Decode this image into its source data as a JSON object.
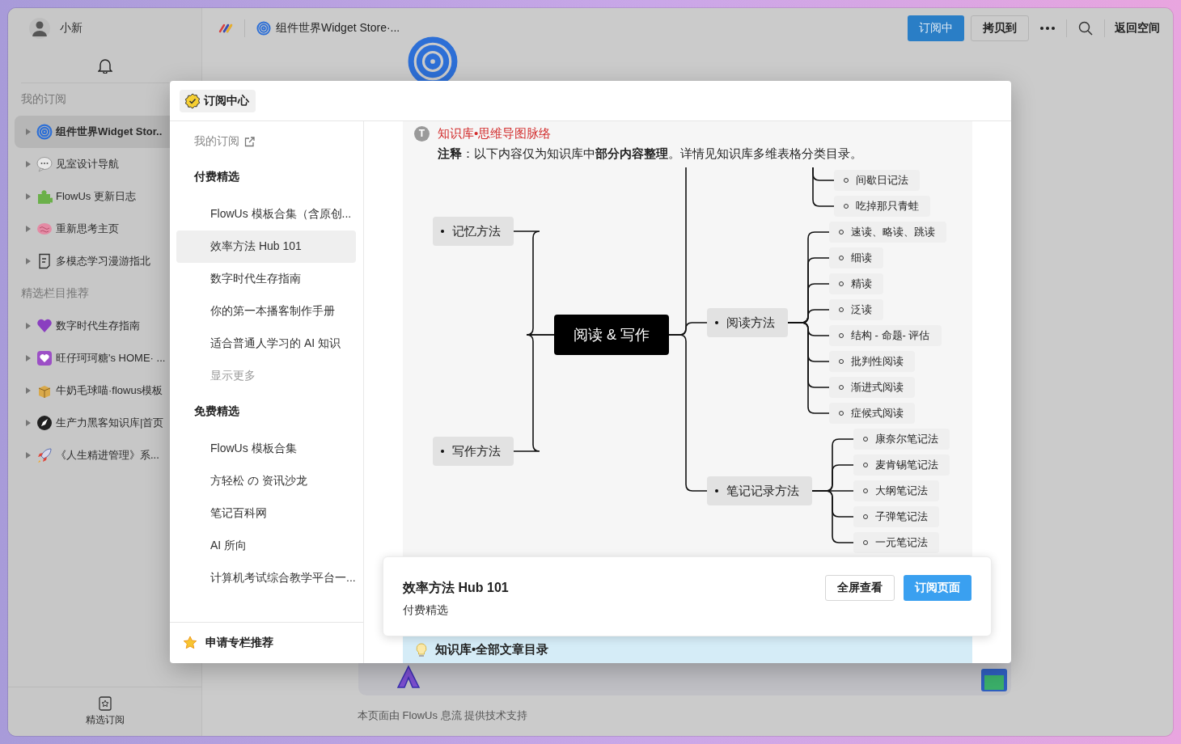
{
  "sidebar": {
    "user": {
      "name": "小新"
    },
    "sections": [
      {
        "title": "我的订阅",
        "items": [
          {
            "label": "组件世界Widget Stor..",
            "selected": true
          },
          {
            "label": "见室设计导航",
            "selected": false
          },
          {
            "label": "FlowUs 更新日志",
            "selected": false
          },
          {
            "label": "重新思考主页",
            "selected": false
          },
          {
            "label": "多模态学习漫游指北",
            "selected": false
          }
        ]
      },
      {
        "title": "精选栏目推荐",
        "items": [
          {
            "label": "数字时代生存指南",
            "selected": false
          },
          {
            "label": "旺仔珂珂糖's HOME· ...",
            "selected": false
          },
          {
            "label": "牛奶毛球喵·flowus模板",
            "selected": false
          },
          {
            "label": "生产力黑客知识库|首页",
            "selected": false
          },
          {
            "label": "《人生精进管理》系...",
            "selected": false
          }
        ]
      }
    ],
    "footer": "精选订阅"
  },
  "topbar": {
    "title": "组件世界Widget Store·...",
    "buttons": [
      {
        "label": "订阅中",
        "kind": "primary"
      },
      {
        "label": "拷贝到",
        "kind": "outline"
      }
    ],
    "back": "返回空间"
  },
  "footer_note": "本页面由 FlowUs 息流 提供技术支持",
  "modal": {
    "title": "订阅中心",
    "my_subscriptions": "我的订阅",
    "groups": [
      {
        "title": "付费精选",
        "items": [
          {
            "label": "FlowUs 模板合集（含原创...",
            "selected": false
          },
          {
            "label": "效率方法 Hub 101",
            "selected": true
          },
          {
            "label": "数字时代生存指南",
            "selected": false
          },
          {
            "label": "你的第一本播客制作手册",
            "selected": false
          },
          {
            "label": "适合普通人学习的 AI 知识",
            "selected": false
          }
        ],
        "show_more": "显示更多"
      },
      {
        "title": "免费精选",
        "items": [
          {
            "label": "FlowUs 模板合集",
            "selected": false
          },
          {
            "label": "方轻松 の 资讯沙龙",
            "selected": false
          },
          {
            "label": "笔记百科网",
            "selected": false
          },
          {
            "label": "AI 所向",
            "selected": false
          },
          {
            "label": "计算机考试综合教学平台一...",
            "selected": false
          }
        ]
      }
    ],
    "apply": "申请专栏推荐",
    "preview": {
      "badge": "T",
      "heading": "知识库•思维导图脉络",
      "note": "**注释**：以下内容仅为知识库中**部分内容整理**。详情见知识库多维表格分类目录。",
      "mindmap": {
        "center": "阅读 & 写作",
        "left": [
          {
            "label": "记忆方法"
          },
          {
            "label": "写作方法"
          }
        ],
        "right": [
          {
            "children": [
              {
                "label": "间歇日记法"
              },
              {
                "label": "吃掉那只青蛙"
              }
            ]
          },
          {
            "label": "阅读方法",
            "children": [
              {
                "label": "速读、略读、跳读"
              },
              {
                "label": "细读"
              },
              {
                "label": "精读"
              },
              {
                "label": "泛读"
              },
              {
                "label": "结构 - 命题- 评估"
              },
              {
                "label": "批判性阅读"
              },
              {
                "label": "渐进式阅读"
              },
              {
                "label": "症候式阅读"
              }
            ]
          },
          {
            "label": "笔记记录方法",
            "children": [
              {
                "label": "康奈尔笔记法"
              },
              {
                "label": "麦肯锡笔记法"
              },
              {
                "label": "大纲笔记法"
              },
              {
                "label": "子弹笔记法"
              },
              {
                "label": "一元笔记法"
              }
            ]
          }
        ]
      },
      "callout": "知识库•全部文章目录"
    },
    "card": {
      "title": "效率方法 Hub 101",
      "subtitle": "付费精选",
      "buttons": [
        {
          "label": "全屏查看",
          "kind": "outline"
        },
        {
          "label": "订阅页面",
          "kind": "primary"
        }
      ]
    }
  }
}
